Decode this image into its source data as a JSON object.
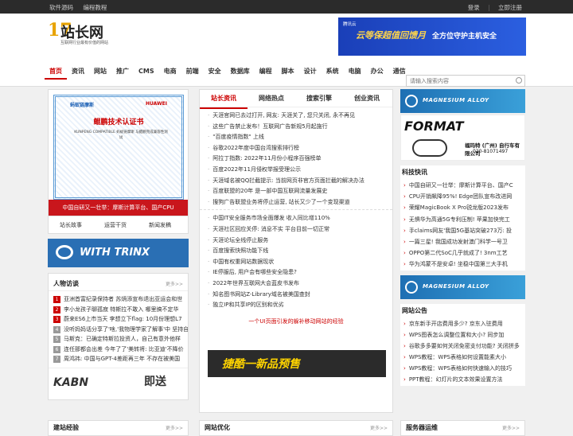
{
  "topbar": {
    "left": [
      "软件源码",
      "编程教程"
    ],
    "login": "登录",
    "register": "立即注册"
  },
  "logo": {
    "num": "17",
    "name": "站长网",
    "slogan": "互联网行业最有价值的网站"
  },
  "banner": {
    "label": "腾讯云",
    "headline": "云等保超值回馈月",
    "tagline": "全方位守护主机安全"
  },
  "nav": [
    "首页",
    "资讯",
    "网站",
    "推广",
    "CMS",
    "电商",
    "前端",
    "安全",
    "数据库",
    "编程",
    "脚本",
    "设计",
    "系统",
    "电脑",
    "办公",
    "通信"
  ],
  "search": {
    "placeholder": "请输入搜索内容"
  },
  "left": {
    "cert": {
      "logo_left": "蚂蚁链摩斯",
      "logo_right": "HUAWEI",
      "title": "鲲鹏技术认证书",
      "text": "KUNPENG COMPATIBLE 蚂蚁链摩斯 与鲲鹏完成兼容性测试",
      "caption": "中国自研又一壮举：摩斯计算平台、国产CPU"
    },
    "quick_links": [
      "站长故事",
      "运营干货",
      "新闻发稿"
    ],
    "trinx": "WITH TRINX",
    "people": {
      "title": "人物访谈",
      "more": "更多>>",
      "items": [
        "亚洲首富纪录保持者 苏炳添宣布退出亚运会和世",
        "李小龙孩子聊孤寂 特斯拉不敢入 哪里搞不定华",
        "蔚来ES6上市当天 李想立下flag: 10月份理想L7",
        "没听妈妈话分享了'啥,'我物理学家了解事'中 坚持自",
        "马斯克：已确定特斯拉投资人，自己有意外他样",
        "连任那都会出差 今年了了'美转将: 比亚迪'不降价",
        "周鸿祎: 中国与GPT-4差距再三年 不存在被美国"
      ]
    },
    "kabn": {
      "brand": "KABN",
      "jd": "即送"
    }
  },
  "center": {
    "tabs": [
      "站长资讯",
      "网络热点",
      "搜索引擎",
      "创业资讯"
    ],
    "list1": [
      "天涯官网已去过打开, 网友: 天涯关了, 您只关闭, 永不再见",
      "这些广告禁止发布！互联网广告新规5月起施行",
      "\"百度疫情指数\" 上线",
      "谷歌2022年度中国台湾搜索排行榜",
      "阿拉丁指数: 2022年11月份小程序百强榜单",
      "百度2022年11月侵权举报受理公示",
      "天涯域名被QQ拦截提示: 当前网页非官方页面拦截的解决办法",
      "百度联盟的20年 是一部中国互联网流量发展史",
      "搜狗广告联盟业务将停止运营, 站长又少了一个变现渠道"
    ],
    "list2": [
      "中国IT安全服务市场全面爆发 收入同比增110%",
      "天涯社区回应关停: 消息不实 平台目前一切正常",
      "天涯论坛全线停止服务",
      "百度搜索快照功能下线",
      "中国有权重网站数据现状",
      "IE停服后, 用户会有哪些安全隐患?",
      "2022年世界互联网大会蓝皮书发布",
      "知名图书网站Z-Library域名被美国查封",
      "独立IP和共享IP的区别和优劣"
    ],
    "promo": "一个UI页面引发的躲补移动网站的经验",
    "jiechi": "捷酷一新品预售"
  },
  "right": {
    "mag1": "MAGNESIUM ALLOY",
    "format": {
      "brand": "FORMAT",
      "s1": "福玛特 (广州) 自行车有限公司",
      "s2": "020-81071497"
    },
    "tech_title": "科技快讯",
    "tech": [
      "中国自研又一壮举：摩斯计算平台、国产C",
      "CPU开销飙降95%! Edge团队宣布改进网",
      "荣耀MagicBook X Pro锐龙版2023发布",
      "无惧华为高通5G专利压制! 苹果加快完工",
      "手claims网友'我国5G基站突破273万: 投",
      "一篇三星! 我国成功发射澳门科学一号卫",
      "OPPO第二代SoC几乎就成了! 3nm工艺",
      "华为鸿蒙不是安卓! 坐稳中国第三大手机"
    ],
    "mag2": "MAGNESIUM ALLOY",
    "notice_title": "网站公告",
    "notice": [
      "京东新手开店费用多少? 京东入驻费用",
      "WPS图表怎么调整位置和大小? 同步加",
      "谷歌多多要如何关闭免密支付功能? 关闭拼多",
      "WPS教程：WPS表格如何设置能素大小",
      "WPS教程：WPS表格如何快速输入的技巧",
      "PPT教程：幻灯片的文本效果设置方法"
    ]
  },
  "bottom": {
    "a": "建站经验",
    "b": "网站优化",
    "c": "服务器运维",
    "more": "更多>>"
  }
}
